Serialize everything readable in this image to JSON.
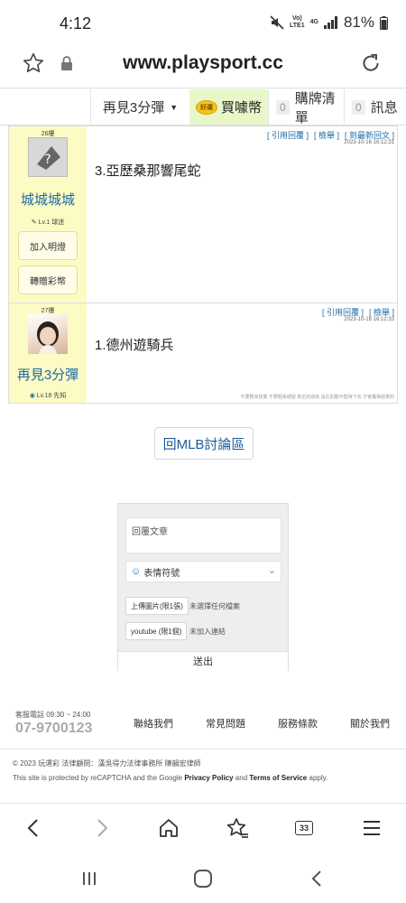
{
  "status_bar": {
    "time": "4:12",
    "volte": "Vo))\nLTE1",
    "network": "4G",
    "battery": "81%"
  },
  "browser": {
    "url": "www.playsport.cc"
  },
  "site_nav": {
    "user_menu": "再見3分彈",
    "coin_badge": "好運",
    "buy_coin": "買噱幣",
    "cart_count": "0",
    "cart": "購牌清單",
    "msg_count": "0",
    "messages": "訊息"
  },
  "posts": [
    {
      "floor": "26樓",
      "user": "城城城城",
      "level": "Lv.1 球迷",
      "follow": "加入明燈",
      "gift": "轉贈彩幣",
      "actions": [
        "[ 引用回覆 ]",
        "[ 檢舉 ]",
        "[ 到最新回文 ]"
      ],
      "time": "2023-10-16 16:12:31",
      "content": "3.亞歷桑那響尾蛇"
    },
    {
      "floor": "27樓",
      "user": "再見3分彈",
      "level": "Lv.18 先知",
      "actions": [
        "[ 引用回覆 ]",
        "[ 檢舉 ]"
      ],
      "time": "2023-10-16 16:12:33",
      "content": "1.德州遊騎兵",
      "disclaimer": "不要輕易放棄 不要輕易絕望 真正的成就 是在別酸中堅持下去 才會獲得結果的"
    }
  ],
  "back_button": "回MLB討論區",
  "reply": {
    "placeholder": "回覆文章",
    "emoji": "表情符號",
    "upload_image": "上傳圖片(限1張)",
    "upload_image_note": "未選擇任何檔案",
    "youtube": "youtube (限1個)",
    "youtube_note": "未加入連結",
    "submit": "送出"
  },
  "footer": {
    "hours": "客服電話 09:30 ~ 24:00",
    "phone": "07-9700123",
    "links": [
      "聯絡我們",
      "常見問題",
      "服務條款",
      "關於我們"
    ],
    "copyright": "© 2023 玩運彩  法律顧問：漢吳得力法律事務所 陳韻宏律師",
    "recaptcha_prefix": "This site is protected by reCAPTCHA and the Google ",
    "privacy": "Privacy Policy",
    "and": " and ",
    "terms": "Terms of Service",
    "apply": " apply."
  },
  "toolbar": {
    "tab_count": "33"
  },
  "colors": {
    "accent_blue": "#1d6aa5",
    "sidebar_yellow": "#fdfbc4",
    "coin_green": "#e8f7c8"
  }
}
